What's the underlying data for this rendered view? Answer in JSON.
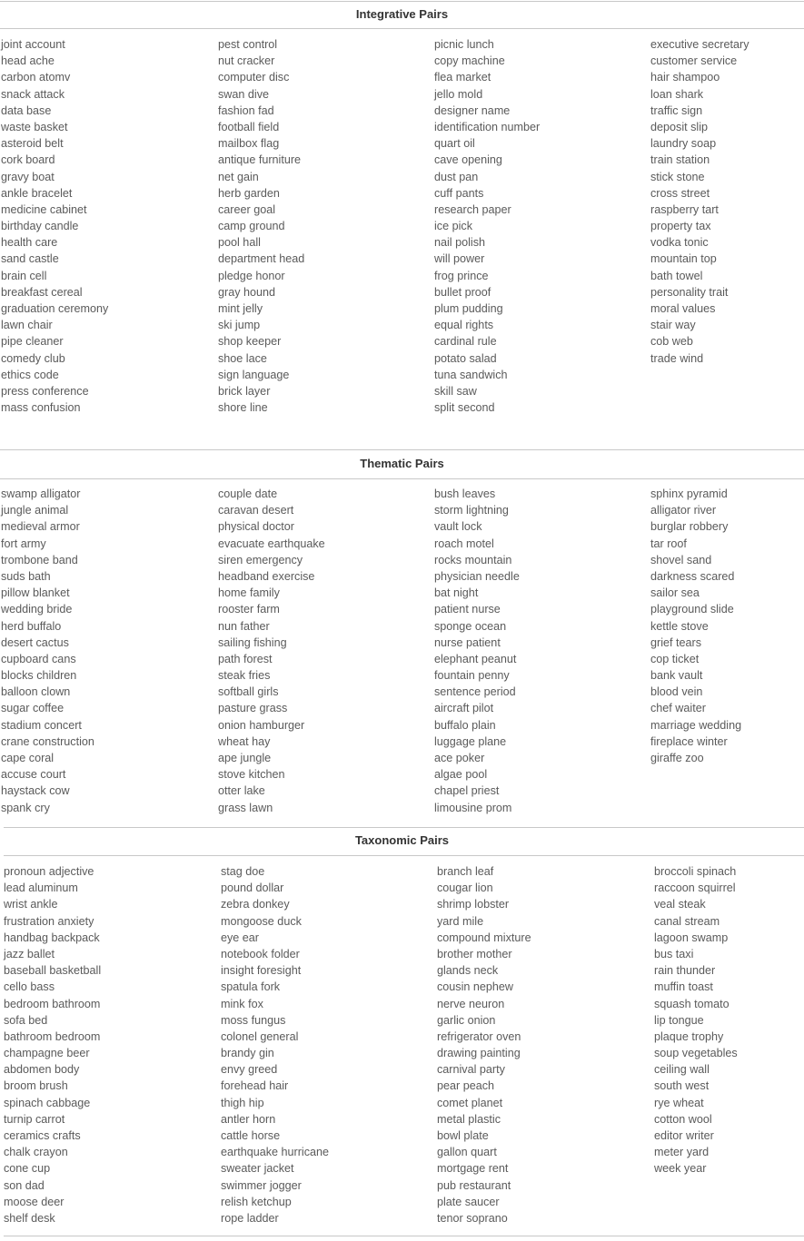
{
  "sections": [
    {
      "title": "Integrative Pairs",
      "columns": [
        [
          "joint account",
          "head ache",
          "carbon atomv",
          "snack attack",
          "data base",
          "waste basket",
          "asteroid belt",
          "cork board",
          "gravy boat",
          "ankle bracelet",
          "medicine cabinet",
          "birthday candle",
          "health care",
          "sand castle",
          "brain cell",
          "breakfast cereal",
          "graduation ceremony",
          "lawn chair",
          "pipe cleaner",
          "comedy club",
          "ethics code",
          "press conference",
          "mass confusion"
        ],
        [
          "pest control",
          "nut cracker",
          "computer disc",
          "swan dive",
          "fashion fad",
          "football field",
          "mailbox flag",
          "antique furniture",
          "net gain",
          "herb garden",
          "career goal",
          "camp ground",
          "pool hall",
          "department head",
          "pledge honor",
          "gray hound",
          "mint jelly",
          "ski jump",
          "shop keeper",
          "shoe lace",
          "sign language",
          "brick layer",
          "shore line"
        ],
        [
          "picnic lunch",
          "copy machine",
          "flea market",
          "jello mold",
          "designer name",
          "identification number",
          "quart oil",
          "cave opening",
          "dust pan",
          "cuff pants",
          "research paper",
          "ice pick",
          "nail polish",
          "will power",
          "frog prince",
          "bullet proof",
          "plum pudding",
          "equal rights",
          "cardinal rule",
          "potato salad",
          "tuna sandwich",
          "skill saw",
          "split second"
        ],
        [
          "executive secretary",
          "customer service",
          "hair shampoo",
          "loan shark",
          "traffic sign",
          "deposit slip",
          "laundry soap",
          "train station",
          "stick stone",
          "cross street",
          "raspberry tart",
          "property tax",
          "vodka tonic",
          "mountain top",
          "bath towel",
          "personality trait",
          "moral values",
          "stair way",
          "cob web",
          "trade wind"
        ]
      ]
    },
    {
      "title": "Thematic Pairs",
      "columns": [
        [
          "swamp alligator",
          "jungle animal",
          "medieval armor",
          "fort army",
          "trombone band",
          "suds bath",
          "pillow blanket",
          "wedding bride",
          "herd buffalo",
          "desert cactus",
          "cupboard cans",
          "blocks children",
          "balloon clown",
          "sugar coffee",
          "stadium concert",
          "crane construction",
          "cape coral",
          "accuse court",
          "haystack cow",
          "spank cry"
        ],
        [
          "couple date",
          "caravan desert",
          "physical doctor",
          "evacuate earthquake",
          "siren emergency",
          "headband exercise",
          "home family",
          "rooster farm",
          "nun father",
          "sailing fishing",
          "path forest",
          "steak fries",
          "softball girls",
          "pasture grass",
          "onion hamburger",
          "wheat hay",
          "ape jungle",
          "stove kitchen",
          "otter lake",
          "grass lawn"
        ],
        [
          "bush leaves",
          "storm lightning",
          "vault lock",
          "roach motel",
          "rocks mountain",
          "physician needle",
          "bat night",
          "patient nurse",
          "sponge ocean",
          "nurse patient",
          "elephant peanut",
          "fountain penny",
          "sentence period",
          "aircraft pilot",
          "buffalo plain",
          "luggage plane",
          "ace poker",
          "algae pool",
          "chapel priest",
          "limousine prom"
        ],
        [
          "sphinx pyramid",
          "alligator river",
          "burglar robbery",
          "tar roof",
          "shovel sand",
          "darkness scared",
          "sailor sea",
          "playground slide",
          "kettle stove",
          "grief tears",
          "cop ticket",
          "bank vault",
          "blood vein",
          "chef waiter",
          "marriage wedding",
          "fireplace winter",
          "giraffe zoo"
        ]
      ]
    },
    {
      "title": "Taxonomic Pairs",
      "columns": [
        [
          "pronoun adjective",
          "lead aluminum",
          "wrist ankle",
          "frustration anxiety",
          "handbag backpack",
          "jazz ballet",
          "baseball basketball",
          "cello bass",
          "bedroom bathroom",
          "sofa bed",
          "bathroom bedroom",
          "champagne beer",
          "abdomen body",
          "broom brush",
          "spinach cabbage",
          "turnip carrot",
          "ceramics crafts",
          "chalk crayon",
          "cone cup",
          "son dad",
          "moose deer",
          "shelf desk"
        ],
        [
          "stag doe",
          "pound dollar",
          "zebra donkey",
          "mongoose duck",
          "eye ear",
          "notebook folder",
          "insight foresight",
          "spatula fork",
          "mink fox",
          "moss fungus",
          "colonel general",
          "brandy gin",
          "envy greed",
          "forehead hair",
          "thigh hip",
          "antler horn",
          "cattle horse",
          "earthquake hurricane",
          "sweater jacket",
          "swimmer jogger",
          "relish ketchup",
          "rope ladder"
        ],
        [
          "branch leaf",
          "cougar lion",
          "shrimp lobster",
          "yard mile",
          "compound mixture",
          "brother mother",
          "glands neck",
          "cousin nephew",
          "nerve neuron",
          "garlic onion",
          "refrigerator oven",
          "drawing painting",
          "carnival party",
          "pear peach",
          "comet planet",
          "metal plastic",
          "bowl plate",
          "gallon quart",
          "mortgage rent",
          "pub restaurant",
          "plate saucer",
          "tenor soprano"
        ],
        [
          "broccoli spinach",
          "raccoon squirrel",
          "veal steak",
          "canal stream",
          "lagoon swamp",
          "bus taxi",
          "rain thunder",
          "muffin toast",
          "squash tomato",
          "lip tongue",
          "plaque trophy",
          "soup vegetables",
          "ceiling wall",
          "south west",
          "rye wheat",
          "cotton wool",
          "editor writer",
          "meter yard",
          "week year"
        ]
      ]
    }
  ]
}
